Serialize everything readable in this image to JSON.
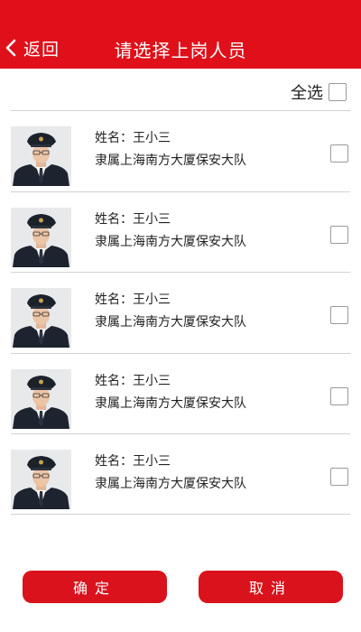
{
  "header": {
    "back_label": "返回",
    "title": "请选择上岗人员",
    "bg_color": "#e0101a"
  },
  "select_all": {
    "label": "全选",
    "checked": false
  },
  "people": [
    {
      "name": "姓名：王小三",
      "unit": "隶属上海南方大厦保安大队",
      "checked": false
    },
    {
      "name": "姓名：王小三",
      "unit": "隶属上海南方大厦保安大队",
      "checked": false
    },
    {
      "name": "姓名：王小三",
      "unit": "隶属上海南方大厦保安大队",
      "checked": false
    },
    {
      "name": "姓名：王小三",
      "unit": "隶属上海南方大厦保安大队",
      "checked": false
    },
    {
      "name": "姓名：王小三",
      "unit": "隶属上海南方大厦保安大队",
      "checked": false
    }
  ],
  "buttons": {
    "confirm": "确定",
    "cancel": "取消"
  }
}
